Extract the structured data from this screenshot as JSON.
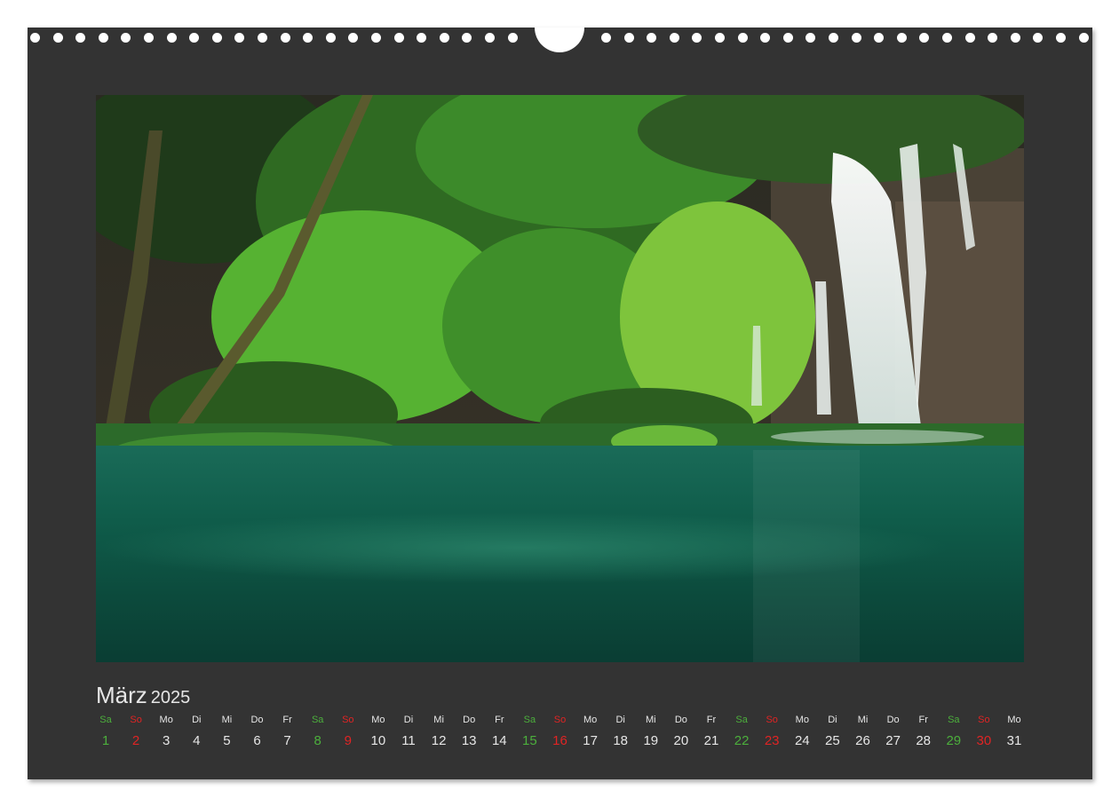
{
  "calendar": {
    "month": "März",
    "year": "2025",
    "colors": {
      "page_bg": "#333333",
      "weekday": "#e6e6e6",
      "saturday": "#4caf3c",
      "sunday": "#e02424"
    },
    "days": [
      {
        "wd": "Sa",
        "d": "1",
        "type": "sat"
      },
      {
        "wd": "So",
        "d": "2",
        "type": "sun"
      },
      {
        "wd": "Mo",
        "d": "3",
        "type": "wk"
      },
      {
        "wd": "Di",
        "d": "4",
        "type": "wk"
      },
      {
        "wd": "Mi",
        "d": "5",
        "type": "wk"
      },
      {
        "wd": "Do",
        "d": "6",
        "type": "wk"
      },
      {
        "wd": "Fr",
        "d": "7",
        "type": "wk"
      },
      {
        "wd": "Sa",
        "d": "8",
        "type": "sat"
      },
      {
        "wd": "So",
        "d": "9",
        "type": "sun"
      },
      {
        "wd": "Mo",
        "d": "10",
        "type": "wk"
      },
      {
        "wd": "Di",
        "d": "11",
        "type": "wk"
      },
      {
        "wd": "Mi",
        "d": "12",
        "type": "wk"
      },
      {
        "wd": "Do",
        "d": "13",
        "type": "wk"
      },
      {
        "wd": "Fr",
        "d": "14",
        "type": "wk"
      },
      {
        "wd": "Sa",
        "d": "15",
        "type": "sat"
      },
      {
        "wd": "So",
        "d": "16",
        "type": "sun"
      },
      {
        "wd": "Mo",
        "d": "17",
        "type": "wk"
      },
      {
        "wd": "Di",
        "d": "18",
        "type": "wk"
      },
      {
        "wd": "Mi",
        "d": "19",
        "type": "wk"
      },
      {
        "wd": "Do",
        "d": "20",
        "type": "wk"
      },
      {
        "wd": "Fr",
        "d": "21",
        "type": "wk"
      },
      {
        "wd": "Sa",
        "d": "22",
        "type": "sat"
      },
      {
        "wd": "So",
        "d": "23",
        "type": "sun"
      },
      {
        "wd": "Mo",
        "d": "24",
        "type": "wk"
      },
      {
        "wd": "Di",
        "d": "25",
        "type": "wk"
      },
      {
        "wd": "Mi",
        "d": "26",
        "type": "wk"
      },
      {
        "wd": "Do",
        "d": "27",
        "type": "wk"
      },
      {
        "wd": "Fr",
        "d": "28",
        "type": "wk"
      },
      {
        "wd": "Sa",
        "d": "29",
        "type": "sat"
      },
      {
        "wd": "So",
        "d": "30",
        "type": "sun"
      },
      {
        "wd": "Mo",
        "d": "31",
        "type": "wk"
      }
    ]
  }
}
